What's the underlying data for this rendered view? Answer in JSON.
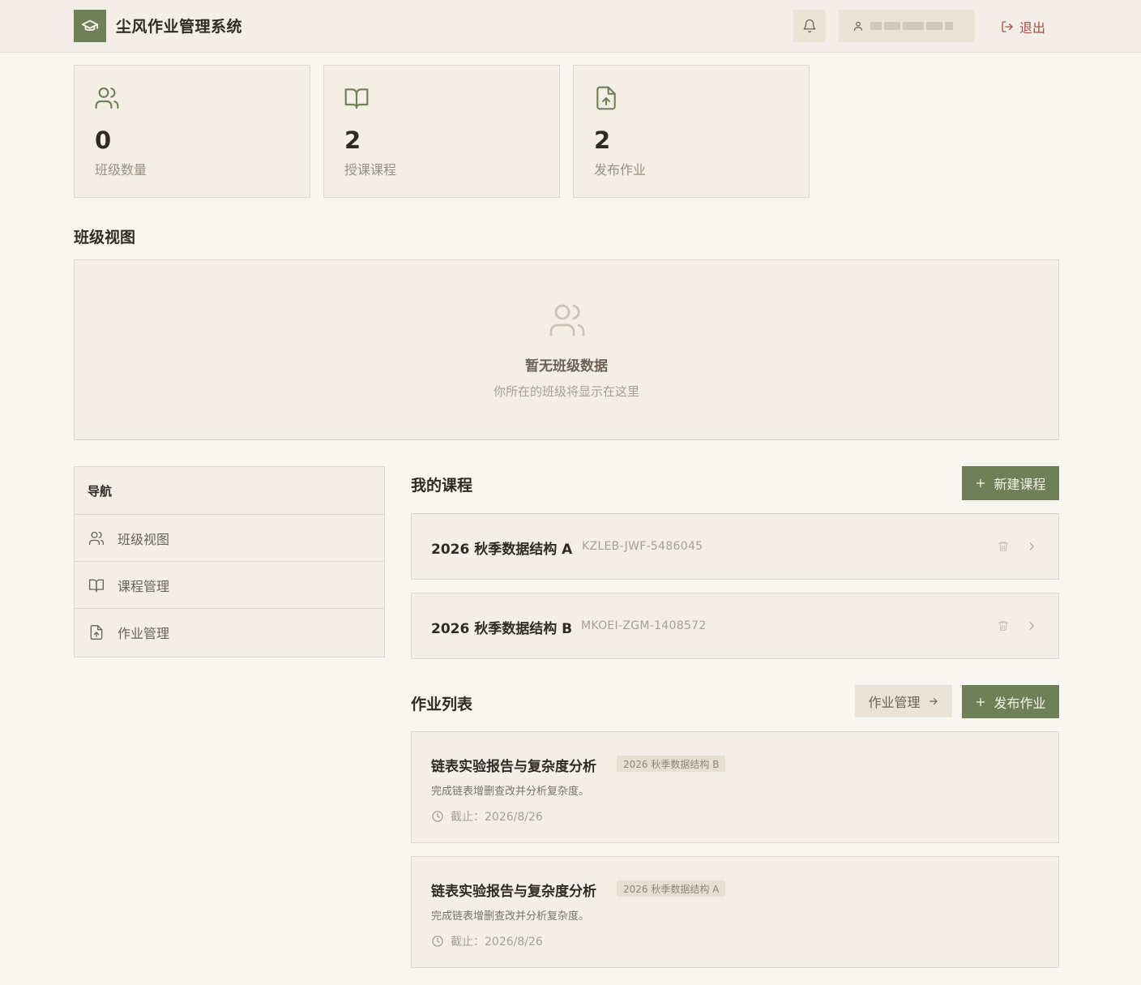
{
  "header": {
    "app_title": "尘风作业管理系统",
    "logout_label": "退出",
    "icons": {
      "logo": "graduation-cap-icon",
      "bell": "bell-icon",
      "user": "user-icon",
      "logout": "logout-icon"
    }
  },
  "stats": [
    {
      "value": "0",
      "label": "班级数量",
      "icon": "users-icon"
    },
    {
      "value": "2",
      "label": "授课课程",
      "icon": "book-open-icon"
    },
    {
      "value": "2",
      "label": "发布作业",
      "icon": "file-upload-icon"
    }
  ],
  "class_view": {
    "title": "班级视图",
    "empty_title": "暂无班级数据",
    "empty_subtitle": "你所在的班级将显示在这里"
  },
  "nav": {
    "title": "导航",
    "items": [
      {
        "label": "班级视图",
        "icon": "users-icon"
      },
      {
        "label": "课程管理",
        "icon": "book-open-icon"
      },
      {
        "label": "作业管理",
        "icon": "file-upload-icon"
      }
    ]
  },
  "courses": {
    "title": "我的课程",
    "new_button": "新建课程",
    "items": [
      {
        "name": "2026 秋季数据结构 A",
        "code": "KZLEB-JWF-5486045"
      },
      {
        "name": "2026 秋季数据结构 B",
        "code": "MKOEI-ZGM-1408572"
      }
    ]
  },
  "homework": {
    "title": "作业列表",
    "manage_button": "作业管理",
    "publish_button": "发布作业",
    "due_prefix": "截止：",
    "items": [
      {
        "title": "链表实验报告与复杂度分析",
        "course": "2026 秋季数据结构 B",
        "desc": "完成链表增删查改并分析复杂度。",
        "due": "2026/8/26"
      },
      {
        "title": "链表实验报告与复杂度分析",
        "course": "2026 秋季数据结构 A",
        "desc": "完成链表增删查改并分析复杂度。",
        "due": "2026/8/26"
      }
    ]
  },
  "colors": {
    "accent": "#6f7f57",
    "background": "#f8f6f1",
    "card": "#f3efe7",
    "logout": "#a0523f"
  }
}
